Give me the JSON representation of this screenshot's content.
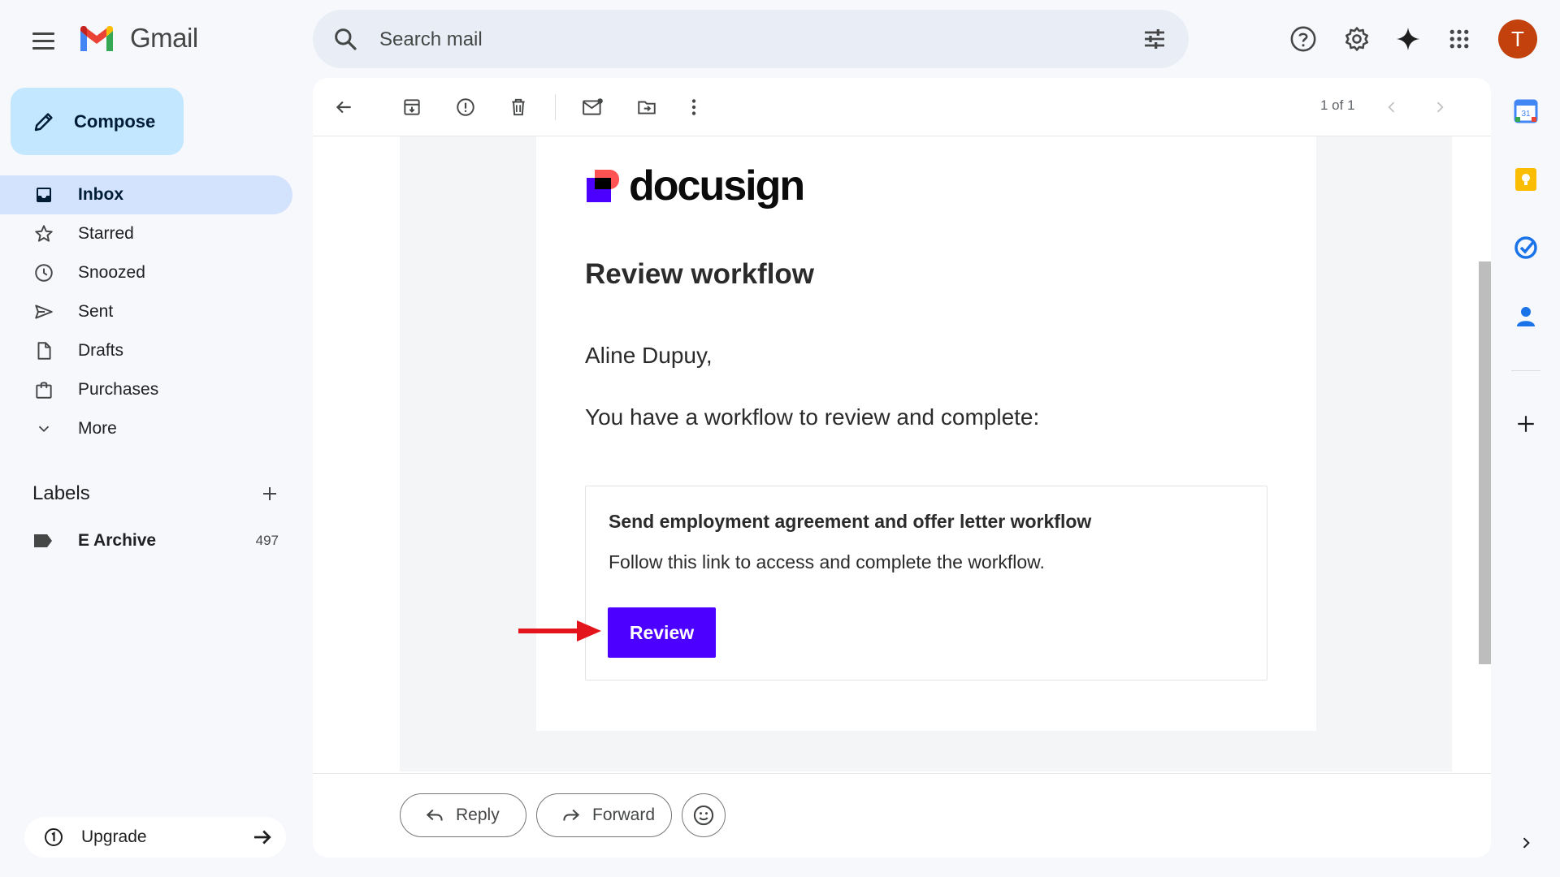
{
  "app": {
    "name": "Gmail"
  },
  "search": {
    "placeholder": "Search mail"
  },
  "user": {
    "avatar_letter": "T",
    "avatar_color": "#c2410c"
  },
  "compose": {
    "label": "Compose"
  },
  "nav": {
    "items": [
      {
        "label": "Inbox",
        "icon": "inbox-icon",
        "active": true
      },
      {
        "label": "Starred",
        "icon": "star-icon"
      },
      {
        "label": "Snoozed",
        "icon": "clock-icon"
      },
      {
        "label": "Sent",
        "icon": "send-icon"
      },
      {
        "label": "Drafts",
        "icon": "draft-icon"
      },
      {
        "label": "Purchases",
        "icon": "shopping-bag-icon"
      },
      {
        "label": "More",
        "icon": "chevron-down-icon"
      }
    ]
  },
  "labels": {
    "heading": "Labels",
    "items": [
      {
        "label": "E Archive",
        "count": "497"
      }
    ]
  },
  "upgrade": {
    "label": "Upgrade"
  },
  "toolbar": {
    "pager": "1 of 1"
  },
  "email": {
    "brand": "docusign",
    "heading": "Review workflow",
    "greeting": "Aline Dupuy,",
    "intro": "You have a workflow to review and complete:",
    "workflow_title": "Send employment agreement and offer letter workflow",
    "workflow_desc": "Follow this link to access and complete the workflow.",
    "review_label": "Review",
    "review_color": "#4c00ff"
  },
  "actions": {
    "reply": "Reply",
    "forward": "Forward"
  },
  "side_panel": {
    "calendar_day": "31"
  }
}
